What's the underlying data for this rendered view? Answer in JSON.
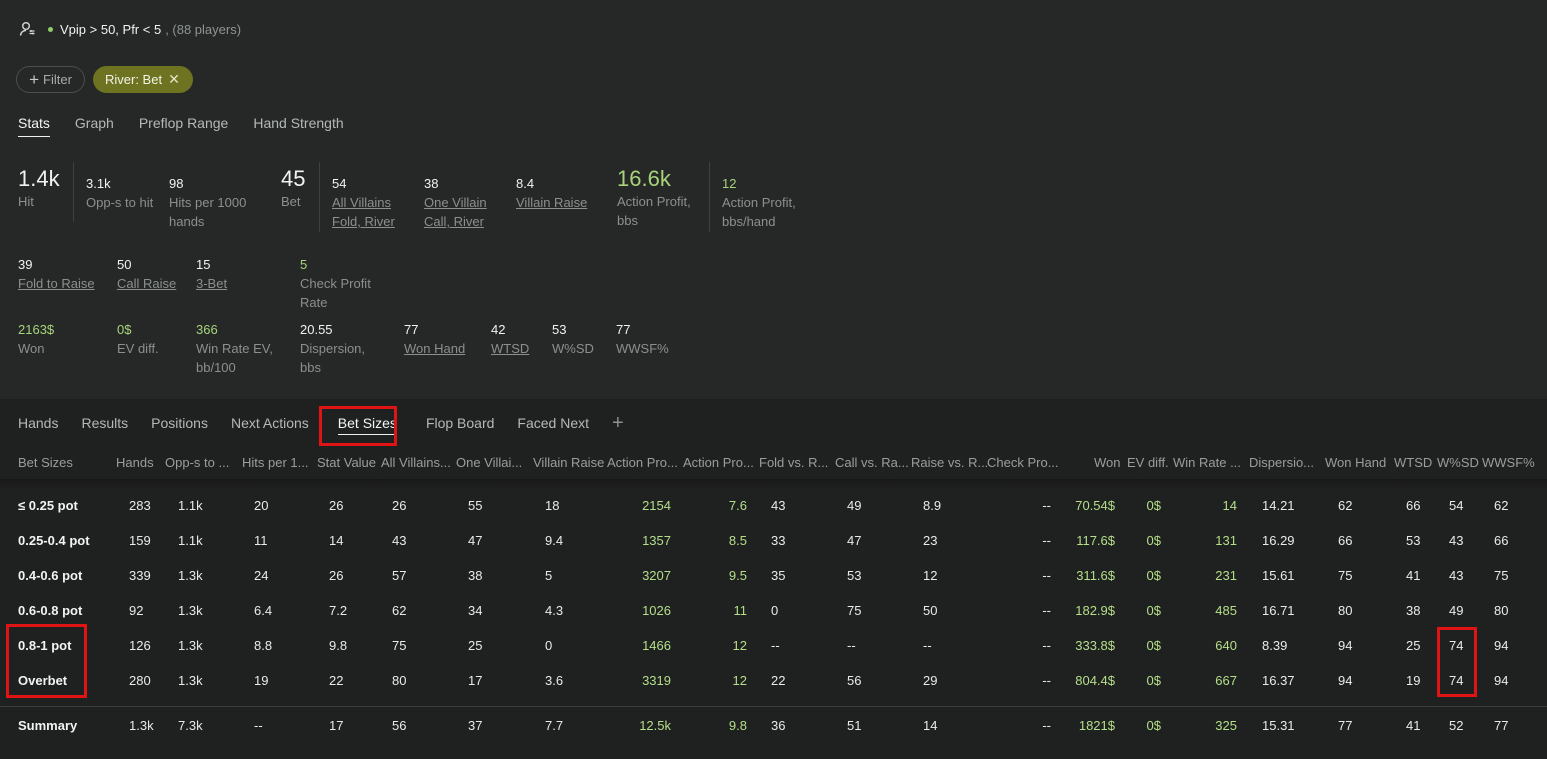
{
  "header": {
    "title": "Vpip > 50, Pfr < 5",
    "count": ", (88 players)",
    "icon": "user-settings-icon"
  },
  "filters": {
    "add_label": "Filter",
    "chip_label": "River: Bet"
  },
  "top_tabs": [
    "Stats",
    "Graph",
    "Preflop Range",
    "Hand Strength"
  ],
  "stats": {
    "hit": {
      "value": "1.4k",
      "label": "Hit"
    },
    "opps": {
      "value": "3.1k",
      "label": "Opp-s to hit"
    },
    "hits1000": {
      "value": "98",
      "label1": "Hits per 1000",
      "label2": "hands"
    },
    "bet": {
      "value": "45",
      "label": "Bet"
    },
    "avfold": {
      "value": "54",
      "label1": "All Villains",
      "label2": "Fold, River"
    },
    "ovcall": {
      "value": "38",
      "label1": "One Villain",
      "label2": "Call, River"
    },
    "vraise": {
      "value": "8.4",
      "label": "Villain Raise"
    },
    "aprofit": {
      "value": "16.6k",
      "label1": "Action Profit,",
      "label2": "bbs"
    },
    "aprofith": {
      "value": "12",
      "label1": "Action Profit,",
      "label2": "bbs/hand"
    },
    "foldraise": {
      "value": "39",
      "label": "Fold to Raise"
    },
    "callraise": {
      "value": "50",
      "label": "Call Raise"
    },
    "threebet": {
      "value": "15",
      "label": "3-Bet"
    },
    "checkprofit": {
      "value": "5",
      "label1": "Check Profit",
      "label2": "Rate"
    },
    "won": {
      "value": "2163$",
      "label": "Won"
    },
    "evdiff": {
      "value": "0$",
      "label": "EV diff."
    },
    "winrate": {
      "value": "366",
      "label1": "Win Rate EV,",
      "label2": "bb/100"
    },
    "dispersion": {
      "value": "20.55",
      "label1": "Dispersion,",
      "label2": "bbs"
    },
    "wonhand": {
      "value": "77",
      "label": "Won Hand"
    },
    "wtsd": {
      "value": "42",
      "label": "WTSD"
    },
    "wsd": {
      "value": "53",
      "label": "W%SD"
    },
    "wwsf": {
      "value": "77",
      "label": "WWSF%"
    }
  },
  "bottom_tabs": [
    "Hands",
    "Results",
    "Positions",
    "Next Actions",
    "Bet Sizes",
    "Flop Board",
    "Faced Next"
  ],
  "table": {
    "columns": [
      "Bet Sizes",
      "Hands",
      "Opp-s to ...",
      "Hits per 1...",
      "Stat Value",
      "All Villains...",
      "One Villai...",
      "Villain Raise",
      "Action Pro...",
      "Action Pro...",
      "Fold vs. R...",
      "Call vs. Ra...",
      "Raise vs. R...",
      "Check Pro...",
      "Won",
      "EV diff.",
      "Win Rate ...",
      "Dispersio...",
      "Won Hand",
      "WTSD",
      "W%SD",
      "WWSF%"
    ],
    "rows": [
      [
        "≤ 0.25 pot",
        "283",
        "1.1k",
        "20",
        "26",
        "26",
        "55",
        "18",
        "2154",
        "7.6",
        "43",
        "49",
        "8.9",
        "--",
        "70.54$",
        "0$",
        "14",
        "14.21",
        "62",
        "66",
        "54",
        "62"
      ],
      [
        "0.25-0.4 pot",
        "159",
        "1.1k",
        "11",
        "14",
        "43",
        "47",
        "9.4",
        "1357",
        "8.5",
        "33",
        "47",
        "23",
        "--",
        "117.6$",
        "0$",
        "131",
        "16.29",
        "66",
        "53",
        "43",
        "66"
      ],
      [
        "0.4-0.6 pot",
        "339",
        "1.3k",
        "24",
        "26",
        "57",
        "38",
        "5",
        "3207",
        "9.5",
        "35",
        "53",
        "12",
        "--",
        "311.6$",
        "0$",
        "231",
        "15.61",
        "75",
        "41",
        "43",
        "75"
      ],
      [
        "0.6-0.8 pot",
        "92",
        "1.3k",
        "6.4",
        "7.2",
        "62",
        "34",
        "4.3",
        "1026",
        "11",
        "0",
        "75",
        "50",
        "--",
        "182.9$",
        "0$",
        "485",
        "16.71",
        "80",
        "38",
        "49",
        "80"
      ],
      [
        "0.8-1 pot",
        "126",
        "1.3k",
        "8.8",
        "9.8",
        "75",
        "25",
        "0",
        "1466",
        "12",
        "--",
        "--",
        "--",
        "--",
        "333.8$",
        "0$",
        "640",
        "8.39",
        "94",
        "25",
        "74",
        "94"
      ],
      [
        "Overbet",
        "280",
        "1.3k",
        "19",
        "22",
        "80",
        "17",
        "3.6",
        "3319",
        "12",
        "22",
        "56",
        "29",
        "--",
        "804.4$",
        "0$",
        "667",
        "16.37",
        "94",
        "19",
        "74",
        "94"
      ]
    ],
    "summary": [
      "Summary",
      "1.3k",
      "7.3k",
      "--",
      "17",
      "56",
      "37",
      "7.7",
      "12.5k",
      "9.8",
      "36",
      "51",
      "14",
      "--",
      "1821$",
      "0$",
      "325",
      "15.31",
      "77",
      "41",
      "52",
      "77"
    ]
  },
  "colors": {
    "accent_green": "#b5df8a",
    "chip": "#6e7322",
    "highlight": "#e01414"
  }
}
